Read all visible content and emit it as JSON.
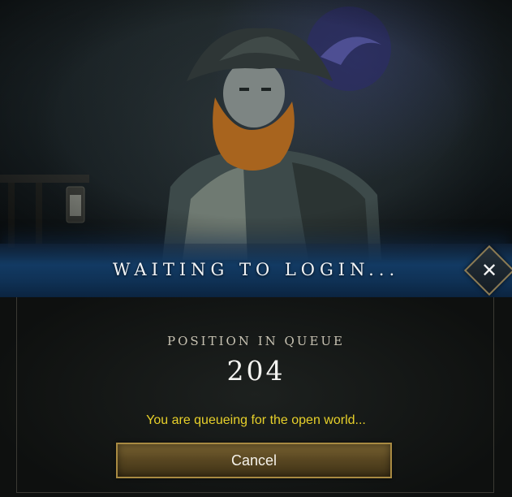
{
  "dialog": {
    "title": "WAITING TO LOGIN...",
    "close_icon": "close-icon",
    "queue_label": "POSITION IN QUEUE",
    "queue_position": "204",
    "status_message": "You are queueing for the open world...",
    "cancel_label": "Cancel"
  },
  "colors": {
    "banner_blue": "#123a63",
    "status_yellow": "#e7d02a",
    "button_gold": "#a88a42"
  }
}
